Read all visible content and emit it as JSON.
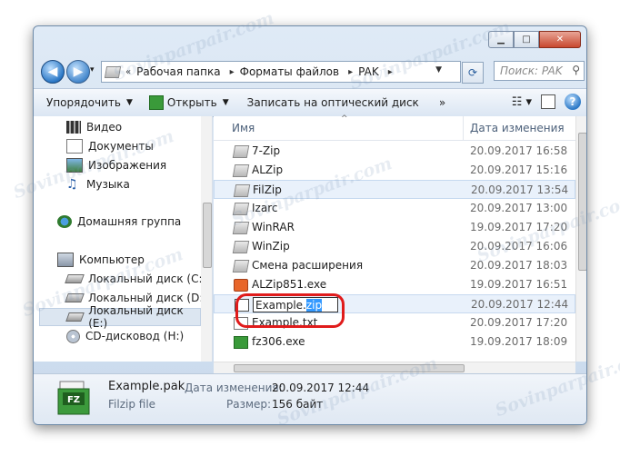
{
  "window": {
    "controls": {
      "minimize": "▁",
      "maximize": "□",
      "close": "✕"
    }
  },
  "nav": {
    "back": "◀",
    "forward": "▶",
    "dropdown": "▾",
    "breadcrumbs": [
      "Рабочая папка",
      "Форматы файлов",
      "PAK"
    ],
    "search_placeholder": "Поиск: PAK"
  },
  "toolbar": {
    "organize": "Упорядочить",
    "open": "Открыть",
    "burn": "Записать на оптический диск",
    "more": "»"
  },
  "sidebar": {
    "items": [
      {
        "label": "Видео",
        "icon": "video-icon"
      },
      {
        "label": "Документы",
        "icon": "documents-icon"
      },
      {
        "label": "Изображения",
        "icon": "pictures-icon"
      },
      {
        "label": "Музыка",
        "icon": "music-icon"
      },
      {
        "label": "Домашняя группа",
        "icon": "homegroup-icon"
      },
      {
        "label": "Компьютер",
        "icon": "computer-icon"
      },
      {
        "label": "Локальный диск (C:)",
        "icon": "disk-c-icon"
      },
      {
        "label": "Локальный диск (D:)",
        "icon": "disk-d-icon"
      },
      {
        "label": "Локальный диск (E:)",
        "icon": "disk-e-icon"
      },
      {
        "label": "CD-дисковод (H:)",
        "icon": "cd-drive-icon"
      }
    ]
  },
  "columns": {
    "name": "Имя",
    "date": "Дата изменения"
  },
  "files": [
    {
      "name": "7-Zip",
      "date": "20.09.2017 16:58",
      "type": "folder"
    },
    {
      "name": "ALZip",
      "date": "20.09.2017 15:16",
      "type": "folder"
    },
    {
      "name": "FilZip",
      "date": "20.09.2017 13:54",
      "type": "folder"
    },
    {
      "name": "Izarc",
      "date": "20.09.2017 13:00",
      "type": "folder"
    },
    {
      "name": "WinRAR",
      "date": "19.09.2017 17:20",
      "type": "folder"
    },
    {
      "name": "WinZip",
      "date": "20.09.2017 16:06",
      "type": "folder"
    },
    {
      "name": "Смена расширения",
      "date": "20.09.2017 18:03",
      "type": "folder"
    },
    {
      "name": "ALZip851.exe",
      "date": "19.09.2017 16:51",
      "type": "exe"
    },
    {
      "name": "Example.zip",
      "date": "20.09.2017 12:44",
      "type": "pak",
      "rename_base": "Example.",
      "rename_sel": "zip"
    },
    {
      "name": "Example.txt",
      "date": "20.09.2017 17:20",
      "type": "txt"
    },
    {
      "name": "fz306.exe",
      "date": "19.09.2017 18:09",
      "type": "exe"
    }
  ],
  "details": {
    "filename": "Example.pak",
    "type": "Filzip file",
    "modified_label": "Дата изменения:",
    "modified_value": "20.09.2017 12:44",
    "size_label": "Размер:",
    "size_value": "156 байт"
  },
  "watermark": "Sovinparpair.com",
  "colors": {
    "accent": "#2b78c6",
    "highlight": "#3399ff",
    "annotation": "#e01b1b"
  }
}
